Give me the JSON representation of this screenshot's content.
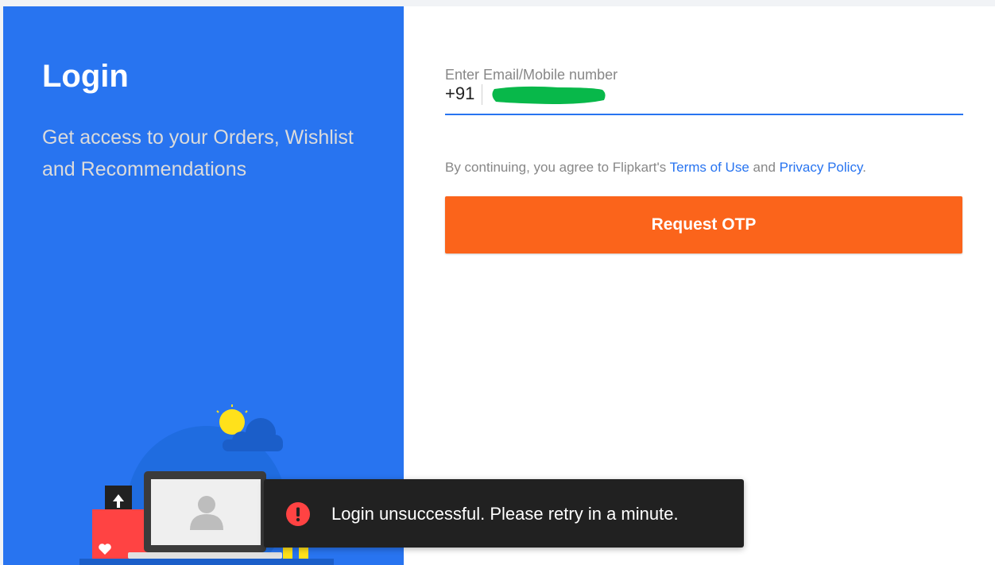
{
  "login": {
    "title": "Login",
    "subtitle": "Get access to your Orders, Wishlist and Recommendations"
  },
  "form": {
    "label": "Enter Email/Mobile number",
    "country_code": "+91",
    "phone_value": "",
    "terms_prefix": "By continuing, you agree to Flipkart's",
    "terms_link": "Terms of Use",
    "terms_and": "and",
    "privacy_link": "Privacy Policy",
    "terms_suffix": ".",
    "submit_label": "Request OTP"
  },
  "toast": {
    "message": "Login unsuccessful. Please retry in a minute.",
    "icon": "error-icon"
  },
  "colors": {
    "brand_blue": "#2874f0",
    "button_orange": "#fb641b",
    "redaction_green": "#08b84a",
    "toast_bg": "#212121",
    "error_red": "#ff4343"
  },
  "icons": [
    "sun-icon",
    "cloud-icon",
    "laptop-icon",
    "user-avatar-icon",
    "shopping-bag-icon",
    "upload-arrow-icon",
    "heart-icon",
    "error-icon"
  ]
}
